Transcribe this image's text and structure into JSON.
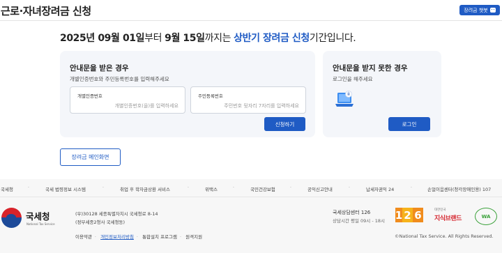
{
  "header": {
    "title": "근로·자녀장려금 신청",
    "chatbot_label": "장려금 챗봇"
  },
  "headline": {
    "date_start": "2025년 09월 01일",
    "from": "부터 ",
    "date_end": "9월 15일",
    "until": "까지는 ",
    "period": "상반기 장려금 신청",
    "suffix": "기간입니다."
  },
  "card_received": {
    "title": "안내문을 받은 경우",
    "description": "개별인증번호와 주민등록번호를 입력해주세요",
    "auth_label": "개별인증번호",
    "auth_placeholder": "개별인증번호(을)를 입력하세요",
    "rrn_label": "주민등록번호",
    "rrn_placeholder": "주민번호 뒷자리 7자리를 입력하세요",
    "submit_label": "신청하기"
  },
  "card_not_received": {
    "title": "안내문을 받지 못한 경우",
    "description": "로그인을 해주세요",
    "login_label": "로그인",
    "icon": "laptop-icon"
  },
  "home_button": "장려금 메인화면",
  "footer": {
    "links": [
      "국세청",
      "국세 법령정보 시스템",
      "취업 후 학자금상환 서비스",
      "위택스",
      "국민건강보험",
      "공익신고안내",
      "납세자권익 24",
      "손얼이음센터(청각장애인용) 107"
    ],
    "org_name": "국세청",
    "org_sub": "National Tax Service",
    "address_1": "(우)30128 세종특별자치시 국세청로 8-14",
    "address_2": "(정부세종2청사 국세청동)",
    "bottom_links": [
      "이용약관",
      "개인정보처리방침",
      "통합설치 프로그램",
      "원격지원"
    ],
    "center_title": "국세상담센터 126",
    "center_hours": "상담시간 평일 09시 - 18시",
    "badge_126": [
      "1",
      "2",
      "6"
    ],
    "brand_small": "대한민국",
    "brand_main": "지식브랜드",
    "wa_badge": "WA",
    "copyright": "©National Tax Service. All Rights Reserved."
  },
  "colors": {
    "primary": "#1f5bc4",
    "card_bg": "#f4f6fa",
    "footer_bg": "#f7f7f7",
    "nts_red": "#d8232a",
    "nts_blue": "#1d4a99"
  }
}
